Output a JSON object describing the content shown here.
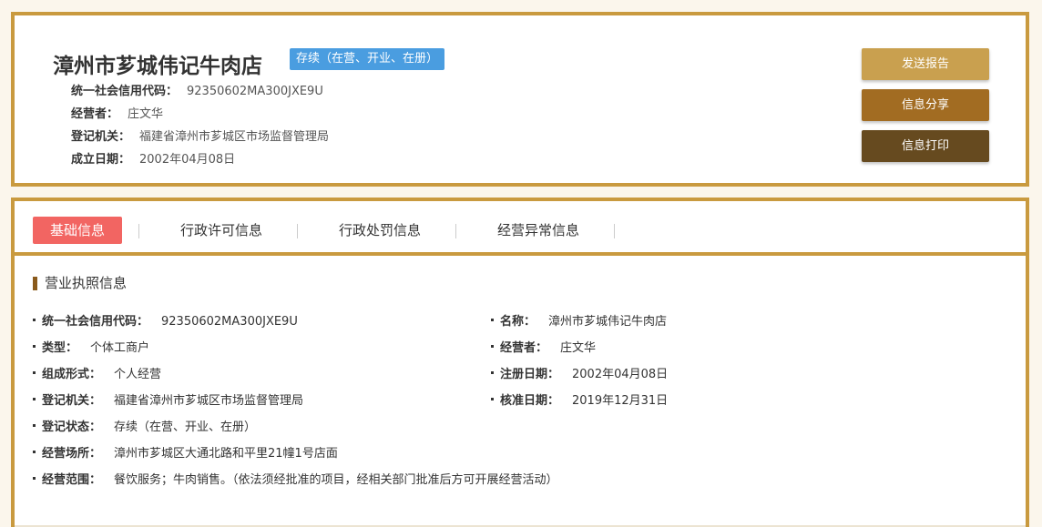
{
  "header": {
    "company_name": "漳州市芗城伟记牛肉店",
    "status_badge": "存续（在营、开业、在册）",
    "info": [
      {
        "label": "统一社会信用代码：",
        "value": "92350602MA300JXE9U"
      },
      {
        "label": "经营者：",
        "value": "庄文华"
      },
      {
        "label": "登记机关：",
        "value": "福建省漳州市芗城区市场监督管理局"
      },
      {
        "label": "成立日期：",
        "value": "2002年04月08日"
      }
    ],
    "buttons": {
      "report": "发送报告",
      "share": "信息分享",
      "print": "信息打印"
    }
  },
  "tabs": [
    {
      "label": "基础信息",
      "active": true
    },
    {
      "label": "行政许可信息",
      "active": false
    },
    {
      "label": "行政处罚信息",
      "active": false
    },
    {
      "label": "经营异常信息",
      "active": false
    }
  ],
  "section": {
    "title": "营业执照信息",
    "left_fields": [
      {
        "label": "统一社会信用代码：",
        "value": "92350602MA300JXE9U"
      },
      {
        "label": "类型：",
        "value": "个体工商户"
      },
      {
        "label": "组成形式：",
        "value": "个人经营"
      },
      {
        "label": "登记机关：",
        "value": "福建省漳州市芗城区市场监督管理局"
      },
      {
        "label": "登记状态：",
        "value": "存续（在营、开业、在册）"
      },
      {
        "label": "经营场所：",
        "value": "漳州市芗城区大通北路和平里21幢1号店面"
      },
      {
        "label": "经营范围：",
        "value": "餐饮服务；牛肉销售。（依法须经批准的项目，经相关部门批准后方可开展经营活动）"
      }
    ],
    "right_fields": [
      {
        "label": "名称：",
        "value": "漳州市芗城伟记牛肉店"
      },
      {
        "label": "经营者：",
        "value": "庄文华"
      },
      {
        "label": "注册日期：",
        "value": "2002年04月08日"
      },
      {
        "label": "核准日期：",
        "value": "2019年12月31日"
      }
    ]
  },
  "colors": {
    "border": "#c99a3f",
    "badge": "#4a9de0",
    "active_tab": "#f26562",
    "btn_report": "#c9a04f",
    "btn_share": "#a26c22",
    "btn_print": "#664a1f"
  }
}
